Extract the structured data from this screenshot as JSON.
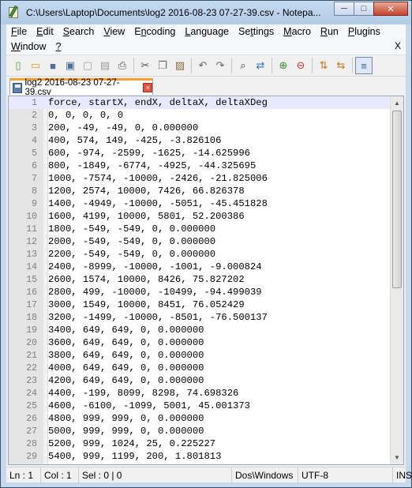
{
  "window": {
    "title": "C:\\Users\\Laptop\\Documents\\log2 2016-08-23 07-27-39.csv - Notepa...",
    "minimize_label": "─",
    "maximize_label": "□",
    "close_label": "✕"
  },
  "menu": {
    "row1": [
      {
        "label": "File",
        "u": "F",
        "rest": "ile"
      },
      {
        "label": "Edit",
        "u": "E",
        "rest": "dit"
      },
      {
        "label": "Search",
        "u": "S",
        "rest": "earch"
      },
      {
        "label": "View",
        "u": "V",
        "rest": "iew"
      },
      {
        "label": "Encoding",
        "u": "n",
        "pre": "E",
        "rest": "coding"
      },
      {
        "label": "Language",
        "u": "L",
        "rest": "anguage"
      },
      {
        "label": "Settings",
        "u": "t",
        "pre": "Se",
        "rest": "tings"
      },
      {
        "label": "Macro",
        "u": "M",
        "rest": "acro"
      },
      {
        "label": "Run",
        "u": "R",
        "rest": "un"
      },
      {
        "label": "Plugins",
        "u": "P",
        "rest": "lugins"
      }
    ],
    "row2": [
      {
        "label": "Window",
        "u": "W",
        "rest": "indow"
      },
      {
        "label": "?",
        "u": "?",
        "rest": ""
      }
    ],
    "close_doc": "X"
  },
  "toolbar": {
    "icons": [
      "new-file-icon",
      "open-file-icon",
      "save-icon",
      "save-all-icon",
      "close-icon",
      "close-all-icon",
      "print-icon",
      "cut-icon",
      "copy-icon",
      "paste-icon",
      "undo-icon",
      "redo-icon",
      "find-icon",
      "replace-icon",
      "zoom-in-icon",
      "zoom-out-icon",
      "sync-vertical-icon",
      "sync-horizontal-icon",
      "word-wrap-icon"
    ]
  },
  "tab": {
    "label": "log2 2016-08-23 07-27-39.csv",
    "close": "×"
  },
  "editor": {
    "lines": [
      {
        "n": "1",
        "t": "force, startX, endX, deltaX, deltaXDeg"
      },
      {
        "n": "2",
        "t": "0, 0, 0, 0, 0"
      },
      {
        "n": "3",
        "t": "200, -49, -49, 0, 0.000000"
      },
      {
        "n": "4",
        "t": "400, 574, 149, -425, -3.826106"
      },
      {
        "n": "5",
        "t": "600, -974, -2599, -1625, -14.625996"
      },
      {
        "n": "6",
        "t": "800, -1849, -6774, -4925, -44.325695"
      },
      {
        "n": "7",
        "t": "1000, -7574, -10000, -2426, -21.825006"
      },
      {
        "n": "8",
        "t": "1200, 2574, 10000, 7426, 66.826378"
      },
      {
        "n": "9",
        "t": "1400, -4949, -10000, -5051, -45.451828"
      },
      {
        "n": "10",
        "t": "1600, 4199, 10000, 5801, 52.200386"
      },
      {
        "n": "11",
        "t": "1800, -549, -549, 0, 0.000000"
      },
      {
        "n": "12",
        "t": "2000, -549, -549, 0, 0.000000"
      },
      {
        "n": "13",
        "t": "2200, -549, -549, 0, 0.000000"
      },
      {
        "n": "14",
        "t": "2400, -8999, -10000, -1001, -9.000824"
      },
      {
        "n": "15",
        "t": "2600, 1574, 10000, 8426, 75.827202"
      },
      {
        "n": "16",
        "t": "2800, 499, -10000, -10499, -94.499039"
      },
      {
        "n": "17",
        "t": "3000, 1549, 10000, 8451, 76.052429"
      },
      {
        "n": "18",
        "t": "3200, -1499, -10000, -8501, -76.500137"
      },
      {
        "n": "19",
        "t": "3400, 649, 649, 0, 0.000000"
      },
      {
        "n": "20",
        "t": "3600, 649, 649, 0, 0.000000"
      },
      {
        "n": "21",
        "t": "3800, 649, 649, 0, 0.000000"
      },
      {
        "n": "22",
        "t": "4000, 649, 649, 0, 0.000000"
      },
      {
        "n": "23",
        "t": "4200, 649, 649, 0, 0.000000"
      },
      {
        "n": "24",
        "t": "4400, -199, 8099, 8298, 74.698326"
      },
      {
        "n": "25",
        "t": "4600, -6100, -1099, 5001, 45.001373"
      },
      {
        "n": "26",
        "t": "4800, 999, 999, 0, 0.000000"
      },
      {
        "n": "27",
        "t": "5000, 999, 999, 0, 0.000000"
      },
      {
        "n": "28",
        "t": "5200, 999, 1024, 25, 0.225227"
      },
      {
        "n": "29",
        "t": "5400, 999, 1199, 200, 1.801813"
      }
    ]
  },
  "status": {
    "ln": "Ln : 1",
    "col": "Col : 1",
    "sel": "Sel : 0 | 0",
    "eol": "Dos\\Windows",
    "encoding": "UTF-8",
    "mode": "INS"
  },
  "colors": {
    "current_line": "#e8e8ff",
    "tab_accent": "#f7a135",
    "line_number": "#808080"
  }
}
